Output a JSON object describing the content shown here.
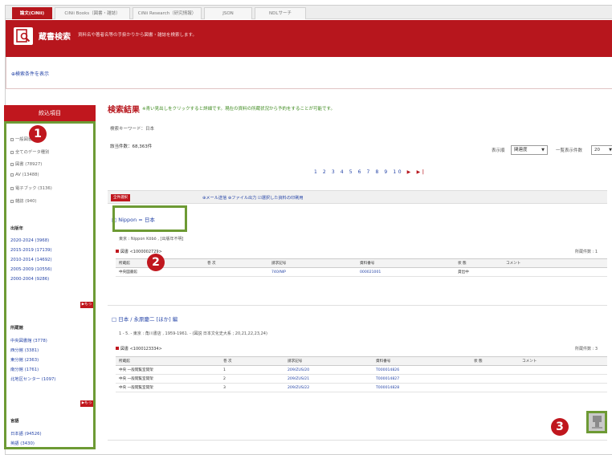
{
  "tabs": [
    {
      "label": "論文(CiNii)",
      "active": true
    },
    {
      "label": "CiNii Books（図書・雑誌）",
      "active": false
    },
    {
      "label": "CiNii Research（研究情報）",
      "active": false
    },
    {
      "label": "JSON",
      "active": false
    },
    {
      "label": "NDLサーチ",
      "active": false
    }
  ],
  "header": {
    "title": "蔵書検索",
    "desc": "資料名や著者名等の手掛かりから図書・雑誌を検索します。"
  },
  "condition": {
    "link": "⊕検索条件を表示"
  },
  "sidebar": {
    "title": "絞込項目",
    "group1": [
      "一般図書",
      "全てのデータ種別",
      "図書 (78927)",
      "AV (13488)",
      "電子ブック (3136)",
      "雑誌 (940)"
    ],
    "group2_title": "出版年",
    "group2": [
      "2020-2024 (3968)",
      "2015-2019 (17139)",
      "2010-2014 (14692)",
      "2005-2009 (10556)",
      "2000-2004 (9286)"
    ],
    "group3_title": "所蔵館",
    "group3": [
      "中央図書館 (3778)",
      "西分館 (3381)",
      "東分館 (2363)",
      "南分館 (1761)",
      "北地区センター (1097)"
    ],
    "group4_title": "言語",
    "group4": [
      "日本語 (94526)",
      "英語 (3430)"
    ],
    "more_label": "▶もっと"
  },
  "main": {
    "title": "検索結果",
    "note": "※青い見出しをクリックすると詳細です。現在の資料の所蔵状況から予約をすることが可能です。",
    "keyword": "検索キーワード：日本",
    "count": "該当件数：68,363件",
    "sort_label": "表示順",
    "sort_value": "関連度",
    "perpage_label": "一覧表示件数",
    "perpage_value": "20",
    "pager": "1 2 3 4 5 6 7 8 9 10",
    "pager_next": "▶ ▶|",
    "toolbar_btn": "全件選択",
    "toolbar_links": "⊕メール送信 ⊕ファイル出力 ☑選択した資料の印刷用"
  },
  "results": [
    {
      "title": "Nippon = 日本",
      "meta": "東京 : Nippon Kōbō , [出版年不明]",
      "holding_label": "図書 <1000002729>",
      "right": "所蔵件数 : 1",
      "columns": [
        "所蔵館",
        "巻 次",
        "請求記号",
        "資料番号",
        "状 態",
        "コメント"
      ],
      "rows": [
        [
          "中央図書館",
          "",
          "740/NIP",
          "000021001",
          "貸出中",
          ""
        ]
      ]
    },
    {
      "title": "日本 / 永原慶二 [ほか] 編",
      "meta": "1 - 5. - 東京 : 角川書店 , 1959-1961. - (図説 日本文化史大系 ; 20,21,22,23,24)",
      "holding_label": "図書 <1000123334>",
      "right": "所蔵件数 : 3",
      "columns": [
        "所蔵館",
        "巻 次",
        "請求記号",
        "資料番号",
        "状 態",
        "コメント"
      ],
      "rows": [
        [
          "中央 一般閲覧室開架",
          "1",
          "209/ZUS/20",
          "T000014826",
          "",
          ""
        ],
        [
          "中央 一般閲覧室開架",
          "2",
          "209/ZUS/21",
          "T000014827",
          "",
          ""
        ],
        [
          "中央 一般閲覧室開架",
          "3",
          "209/ZUS/22",
          "T000014828",
          "",
          ""
        ]
      ]
    }
  ],
  "badges": {
    "one": "1",
    "two": "2",
    "three": "3"
  },
  "colors": {
    "brand_red": "#b7161d",
    "highlight_green": "#6d9a34",
    "link_blue": "#2746a8"
  }
}
